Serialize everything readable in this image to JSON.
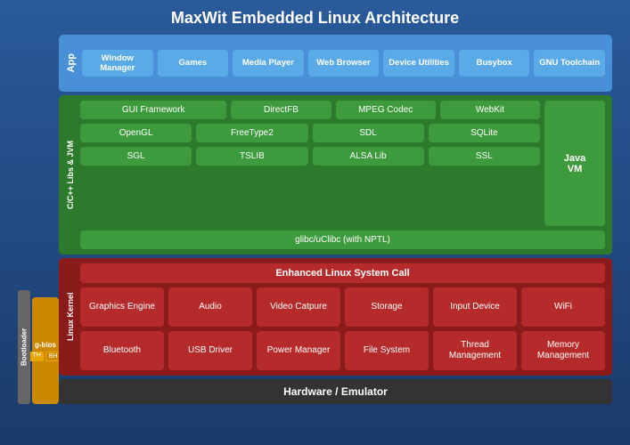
{
  "title": "MaxWit Embedded Linux Architecture",
  "app_layer": {
    "label": "App",
    "items": [
      {
        "id": "window-manager",
        "text": "Window Manager"
      },
      {
        "id": "games",
        "text": "Games"
      },
      {
        "id": "media-player",
        "text": "Media Player"
      },
      {
        "id": "web-browser",
        "text": "Web Browser"
      },
      {
        "id": "device-utilities",
        "text": "Device Utilities"
      },
      {
        "id": "busybox",
        "text": "Busybox"
      },
      {
        "id": "gnu-toolchain",
        "text": "GNU Toolchain"
      }
    ]
  },
  "libs_layer": {
    "label": "C/C++ Libs & JVM",
    "row1": [
      {
        "id": "gui-framework",
        "text": "GUI Framework"
      },
      {
        "id": "directfb",
        "text": "DirectFB"
      },
      {
        "id": "mpeg-codec",
        "text": "MPEG Codec"
      },
      {
        "id": "webkit",
        "text": "WebKit"
      }
    ],
    "row2": [
      {
        "id": "opengl",
        "text": "OpenGL"
      },
      {
        "id": "freetype2",
        "text": "FreeType2"
      },
      {
        "id": "sdl",
        "text": "SDL"
      },
      {
        "id": "sqlite",
        "text": "SQLite"
      }
    ],
    "row3": [
      {
        "id": "sgl",
        "text": "SGL"
      },
      {
        "id": "tslib",
        "text": "TSLIB"
      },
      {
        "id": "alsa-lib",
        "text": "ALSA Lib"
      },
      {
        "id": "ssl",
        "text": "SSL"
      }
    ],
    "glibc": "glibc/uClibc (with NPTL)",
    "javavm": "Java VM"
  },
  "kernel_layer": {
    "label": "Linux Kernel",
    "enhanced": "Enhanced Linux System Call",
    "row1": [
      {
        "id": "graphics-engine",
        "text": "Graphics Engine"
      },
      {
        "id": "audio",
        "text": "Audio"
      },
      {
        "id": "video-capture",
        "text": "Video Catpure"
      },
      {
        "id": "storage",
        "text": "Storage"
      },
      {
        "id": "input-device",
        "text": "Input Device"
      },
      {
        "id": "wifi",
        "text": "WiFi"
      }
    ],
    "row2": [
      {
        "id": "bluetooth",
        "text": "Bluetooth"
      },
      {
        "id": "usb-driver",
        "text": "USB Driver"
      },
      {
        "id": "power-manager",
        "text": "Power Manager"
      },
      {
        "id": "file-system",
        "text": "File System"
      },
      {
        "id": "thread-management",
        "text": "Thread Management"
      },
      {
        "id": "memory-management",
        "text": "Memory Management"
      }
    ]
  },
  "hardware": "Hardware / Emulator",
  "bootloader": {
    "label": "Bootloader",
    "gbios": "g-bios",
    "badge_th": "TH",
    "badge_bh": "BH"
  }
}
